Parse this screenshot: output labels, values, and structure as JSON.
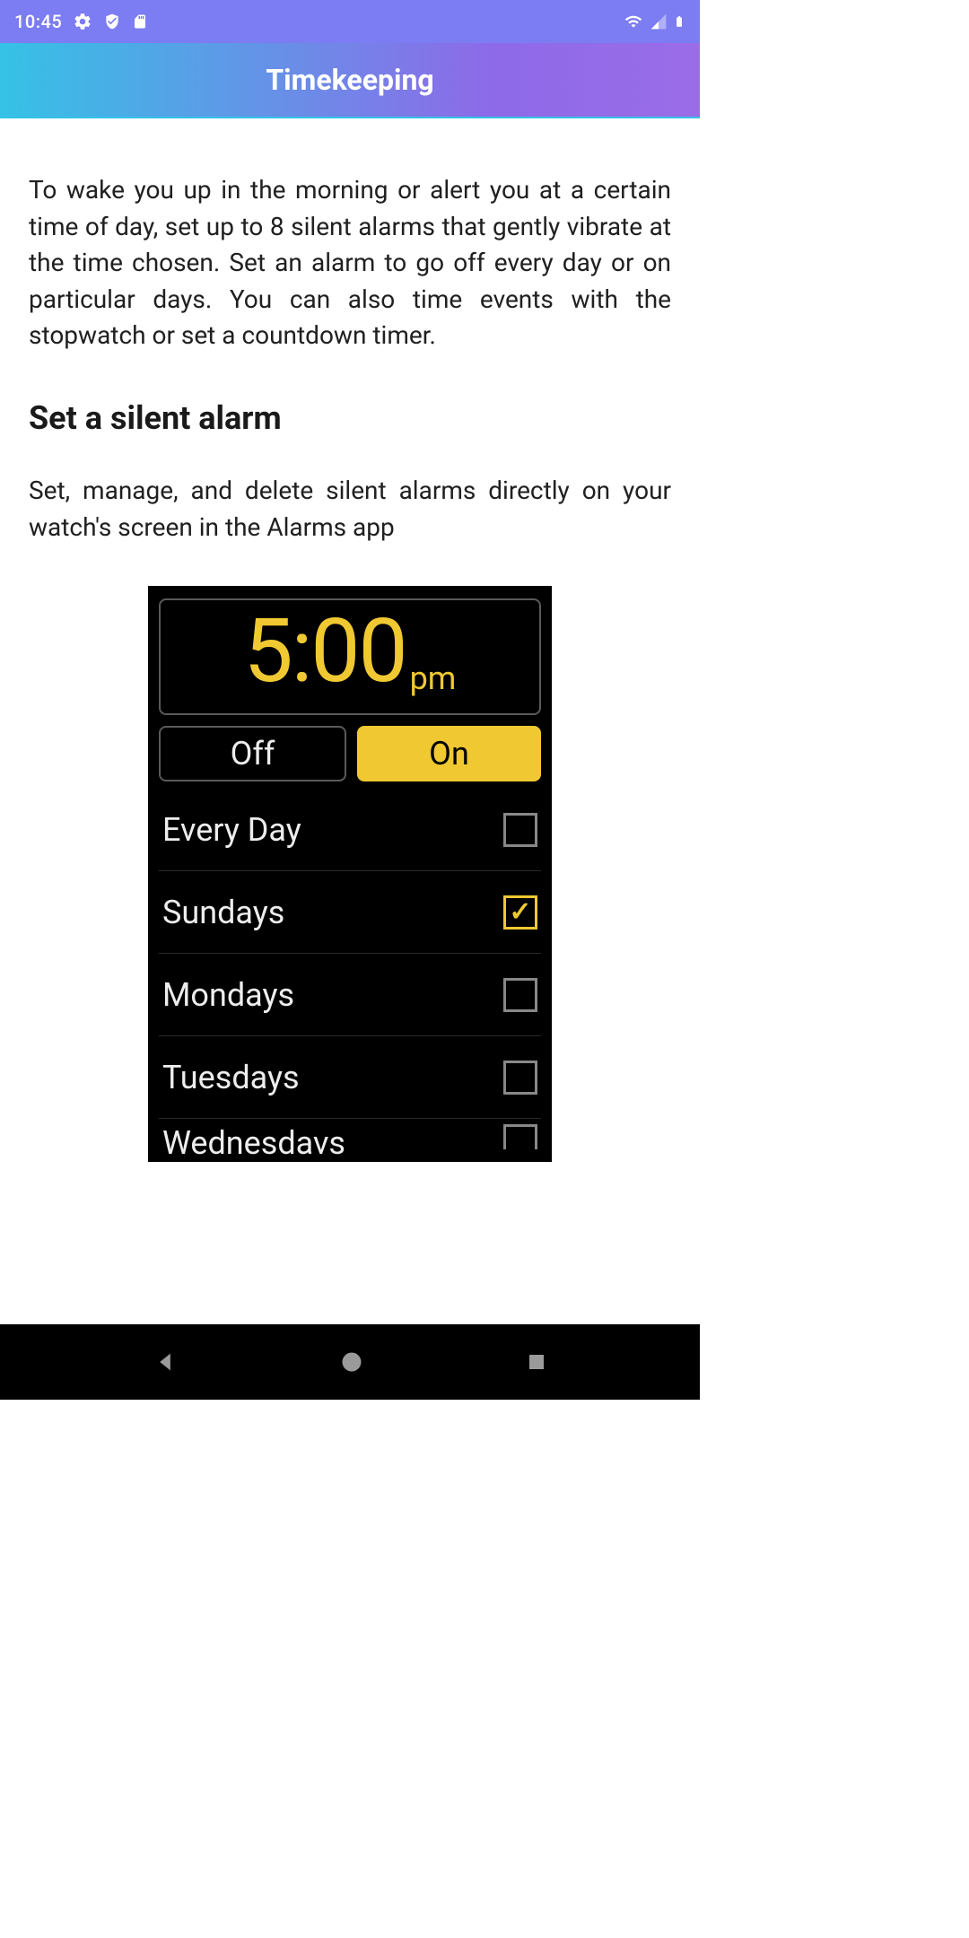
{
  "status": {
    "time": "10:45"
  },
  "header": {
    "title": "Timekeeping"
  },
  "content": {
    "intro": "To wake you up in the morning or alert you at a certain time of day, set up to 8 silent alarms that gently vibrate at the time chosen. Set an alarm to go off every day or on particular days. You can also time events with the stopwatch or set a countdown timer.",
    "section_heading": "Set a silent alarm",
    "section_text": "Set, manage, and delete silent alarms directly on your watch's screen in the Alarms app"
  },
  "watch": {
    "time": "5:00",
    "ampm": "pm",
    "off_label": "Off",
    "on_label": "On",
    "days": [
      {
        "label": "Every Day",
        "checked": false
      },
      {
        "label": "Sundays",
        "checked": true
      },
      {
        "label": "Mondays",
        "checked": false
      },
      {
        "label": "Tuesdays",
        "checked": false
      },
      {
        "label": "Wednesdavs",
        "checked": false
      }
    ]
  }
}
